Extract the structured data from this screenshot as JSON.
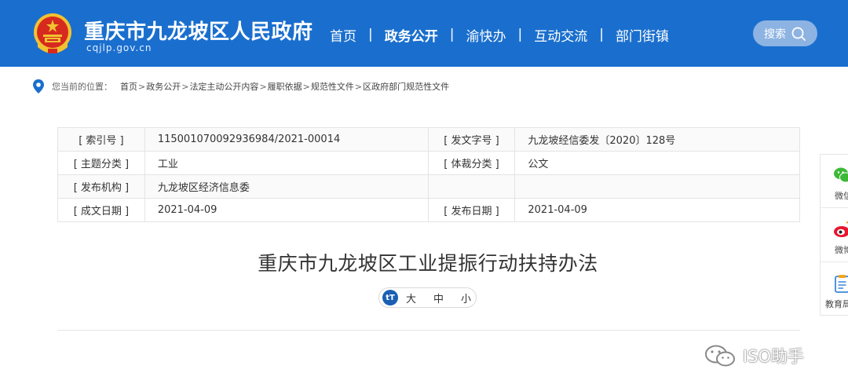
{
  "header": {
    "site_title": "重庆市九龙坡区人民政府",
    "site_domain": "cqjlp.gov.cn",
    "nav": [
      {
        "label": "首页",
        "active": false
      },
      {
        "label": "政务公开",
        "active": true
      },
      {
        "label": "渝快办",
        "active": false
      },
      {
        "label": "互动交流",
        "active": false
      },
      {
        "label": "部门街镇",
        "active": false
      }
    ],
    "nav_separator": "|",
    "search_label": "搜索"
  },
  "breadcrumb": {
    "prefix": "您当前的位置：",
    "items": [
      "首页",
      "政务公开",
      "法定主动公开内容",
      "履职依据",
      "规范性文件",
      "区政府部门规范性文件"
    ],
    "separator": ">"
  },
  "info": {
    "index_label": "[ 索引号 ]",
    "index_value": "11500107009293698​4/2021-00014",
    "doc_no_label": "[ 发文字号 ]",
    "doc_no_value": "九龙坡经信委发〔2020〕128号",
    "topic_label": "[ 主题分类 ]",
    "topic_value": "工业",
    "genre_label": "[ 体裁分类 ]",
    "genre_value": "公文",
    "publisher_label": "[ 发布机构 ]",
    "publisher_value": "九龙坡区经济信息委",
    "written_label": "[ 成文日期 ]",
    "written_value": "2021-04-09",
    "published_label": "[ 发布日期 ]",
    "published_value": "2021-04-09"
  },
  "document": {
    "title": "重庆市九龙坡区工业提振行动扶持办法"
  },
  "font_size": {
    "icon_text": "tT",
    "options": [
      "大",
      "中",
      "小"
    ]
  },
  "share": {
    "items": [
      {
        "label": "微信",
        "icon": "wechat-icon"
      },
      {
        "label": "微博",
        "icon": "weibo-icon"
      },
      {
        "label": "教育局",
        "icon": "clipboard-icon"
      }
    ]
  },
  "watermark": {
    "text": "ISO助手"
  },
  "colors": {
    "header_bg": "#1a6fce",
    "accent": "#1a5fb4",
    "emblem_red": "#d62a1f",
    "emblem_gold": "#f2c230"
  }
}
